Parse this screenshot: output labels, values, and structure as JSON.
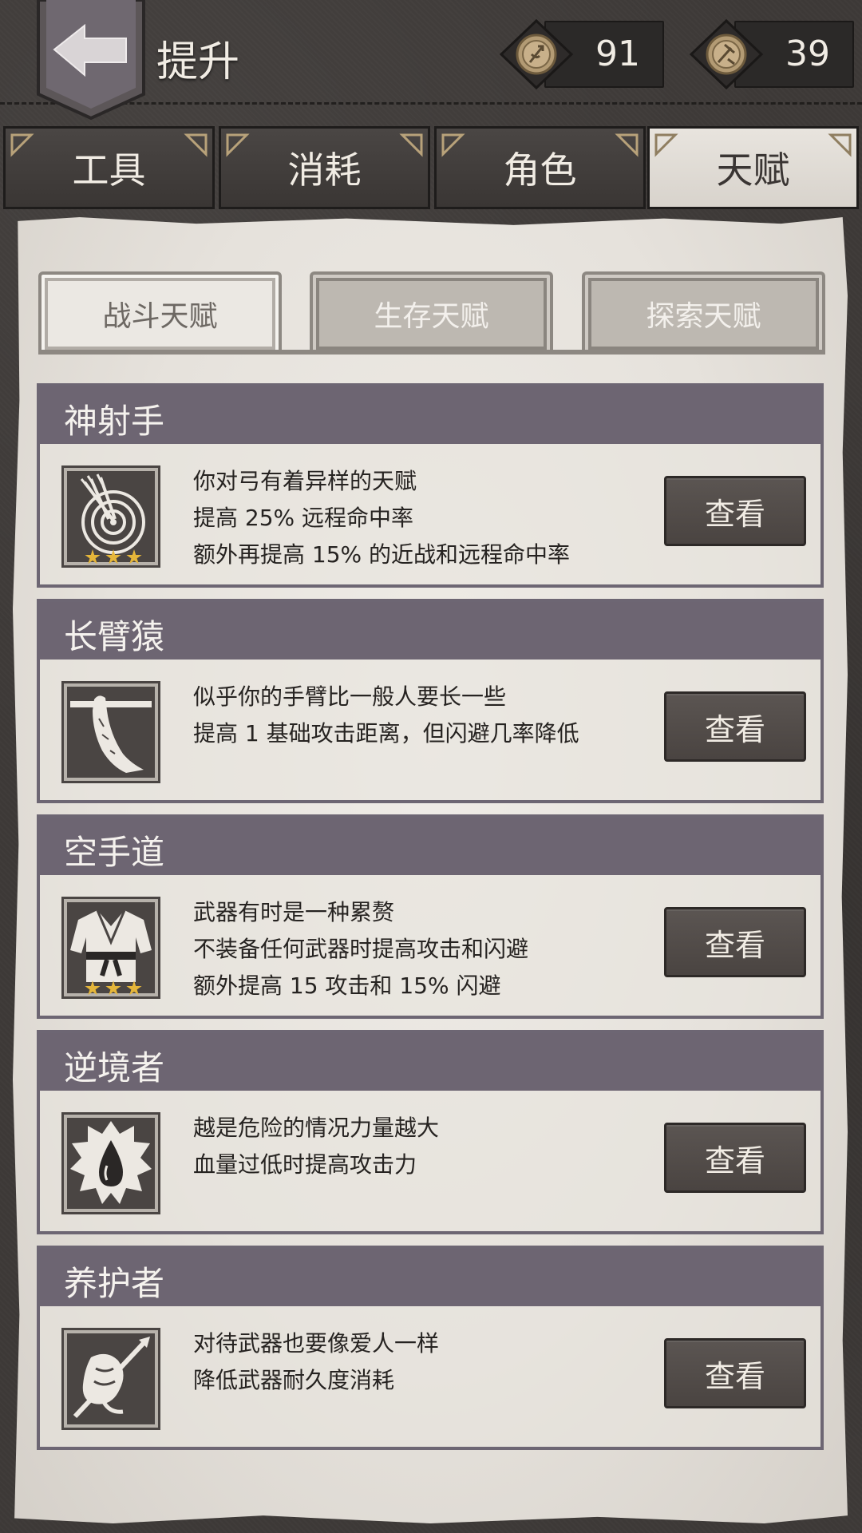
{
  "header": {
    "title": "提升",
    "currencies": [
      {
        "icon": "coin-icon",
        "value": "91"
      },
      {
        "icon": "coin-icon",
        "value": "39"
      }
    ]
  },
  "main_tabs": [
    {
      "label": "工具",
      "active": false
    },
    {
      "label": "消耗",
      "active": false
    },
    {
      "label": "角色",
      "active": false
    },
    {
      "label": "天赋",
      "active": true
    }
  ],
  "sub_tabs": [
    {
      "label": "战斗天赋",
      "active": true
    },
    {
      "label": "生存天赋",
      "active": false
    },
    {
      "label": "探索天赋",
      "active": false
    }
  ],
  "talents": [
    {
      "name": "神射手",
      "icon": "target-arrows-icon",
      "stars": 3,
      "lines": [
        "你对弓有着异样的天赋",
        "提高 25% 远程命中率",
        "额外再提高 15% 的近战和远程命中率"
      ],
      "button": "查看"
    },
    {
      "name": "长臂猿",
      "icon": "hanging-arm-icon",
      "stars": 0,
      "lines": [
        "似乎你的手臂比一般人要长一些",
        "提高 1 基础攻击距离，但闪避几率降低"
      ],
      "button": "查看"
    },
    {
      "name": "空手道",
      "icon": "karate-gi-icon",
      "stars": 3,
      "lines": [
        "武器有时是一种累赘",
        "不装备任何武器时提高攻击和闪避",
        "额外提高 15 攻击和 15% 闪避"
      ],
      "button": "查看"
    },
    {
      "name": "逆境者",
      "icon": "blood-drop-icon",
      "stars": 0,
      "lines": [
        "越是危险的情况力量越大",
        "血量过低时提高攻击力"
      ],
      "button": "查看"
    },
    {
      "name": "养护者",
      "icon": "weapon-care-icon",
      "stars": 0,
      "lines": [
        "对待武器也要像爱人一样",
        "降低武器耐久度消耗"
      ],
      "button": "查看"
    }
  ]
}
